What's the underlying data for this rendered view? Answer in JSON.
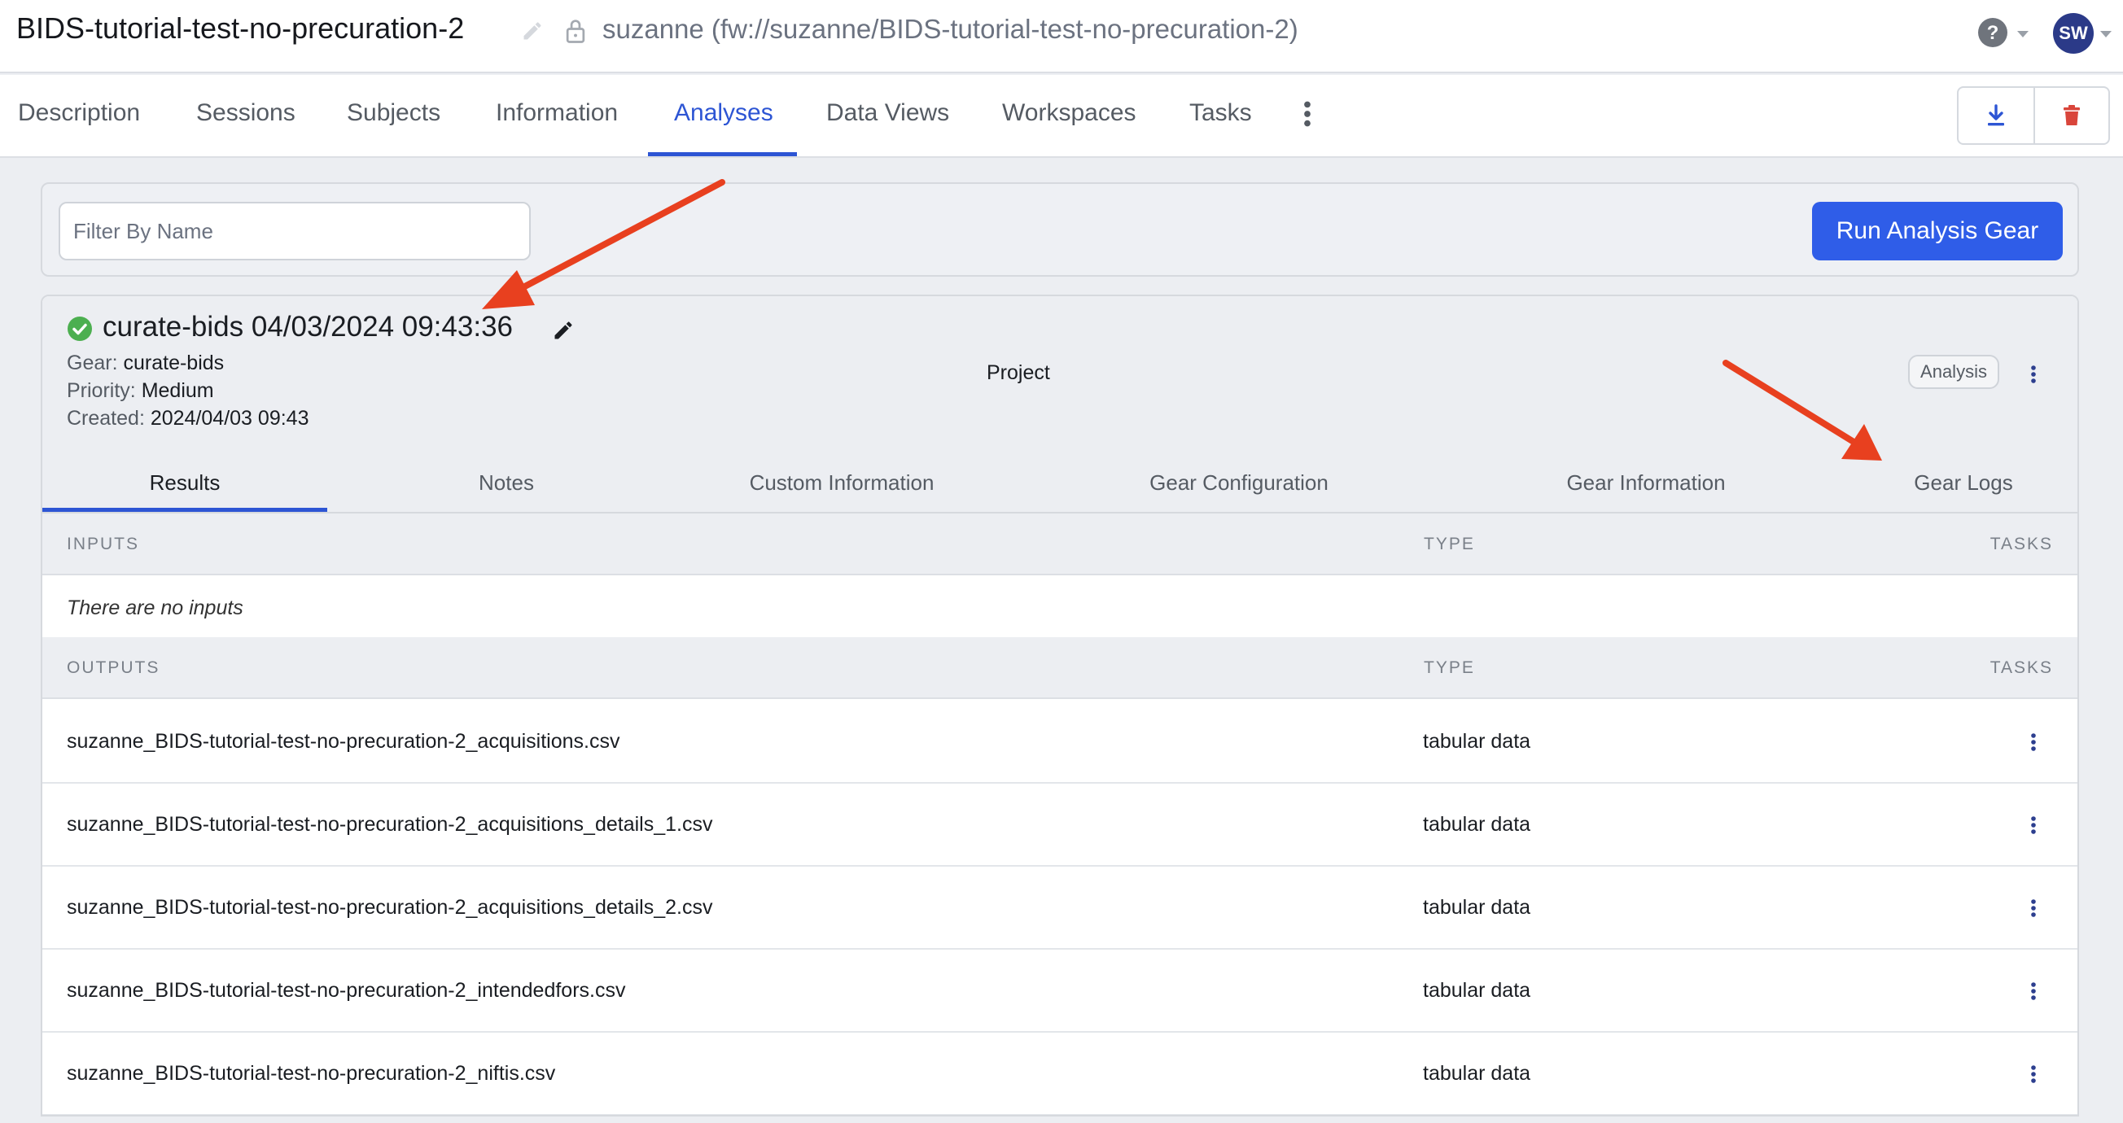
{
  "header": {
    "title": "BIDS-tutorial-test-no-precuration-2",
    "path": "suzanne (fw://suzanne/BIDS-tutorial-test-no-precuration-2)",
    "avatar_initials": "SW",
    "icons": [
      "edit-icon",
      "lock-icon",
      "help-icon",
      "chevron-down-icon"
    ]
  },
  "nav": {
    "tabs": [
      "Description",
      "Sessions",
      "Subjects",
      "Information",
      "Analyses",
      "Data Views",
      "Workspaces",
      "Tasks"
    ],
    "active_tab": "Analyses",
    "action_icons": [
      "download-icon",
      "trash-icon"
    ]
  },
  "filter": {
    "placeholder": "Filter By Name",
    "value": "",
    "run_button": "Run Analysis Gear"
  },
  "analysis": {
    "title": "curate-bids 04/03/2024 09:43:36",
    "status": "success",
    "gear_label": "Gear:",
    "gear_value": "curate-bids",
    "priority_label": "Priority:",
    "priority_value": "Medium",
    "created_label": "Created:",
    "created_value": "2024/04/03 09:43",
    "parent": "Project",
    "badge": "Analysis",
    "subtabs": [
      "Results",
      "Notes",
      "Custom Information",
      "Gear Configuration",
      "Gear Information",
      "Gear Logs"
    ],
    "active_subtab": "Results"
  },
  "inputs": {
    "headers": [
      "INPUTS",
      "TYPE",
      "TASKS"
    ],
    "empty_text": "There are no inputs"
  },
  "outputs": {
    "headers": [
      "OUTPUTS",
      "TYPE",
      "TASKS"
    ],
    "rows": [
      {
        "name": "suzanne_BIDS-tutorial-test-no-precuration-2_acquisitions.csv",
        "type": "tabular data"
      },
      {
        "name": "suzanne_BIDS-tutorial-test-no-precuration-2_acquisitions_details_1.csv",
        "type": "tabular data"
      },
      {
        "name": "suzanne_BIDS-tutorial-test-no-precuration-2_acquisitions_details_2.csv",
        "type": "tabular data"
      },
      {
        "name": "suzanne_BIDS-tutorial-test-no-precuration-2_intendedfors.csv",
        "type": "tabular data"
      },
      {
        "name": "suzanne_BIDS-tutorial-test-no-precuration-2_niftis.csv",
        "type": "tabular data"
      }
    ]
  },
  "colors": {
    "accent": "#2d55d4",
    "primary_button": "#2f5de8",
    "success": "#4caf50",
    "delete": "#d9453b",
    "annotation_arrow": "#e8401f",
    "avatar": "#2b3a88"
  }
}
